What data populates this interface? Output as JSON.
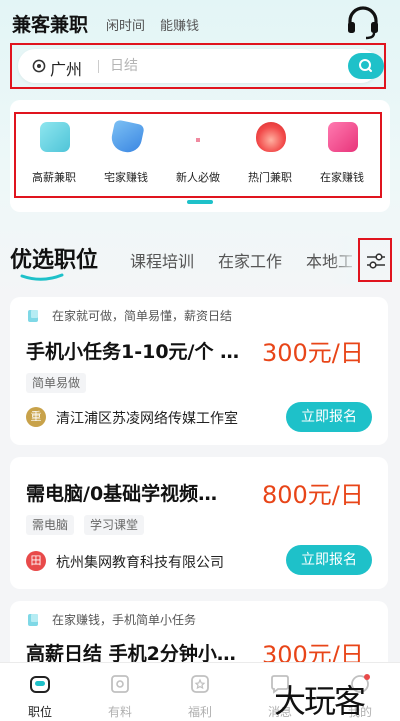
{
  "header": {
    "brand": "兼客兼职",
    "slogan": [
      "闲时间",
      "能赚钱"
    ]
  },
  "search": {
    "city": "广州",
    "placeholder": "日结",
    "icons": [
      "location-icon",
      "search-icon",
      "headset-icon"
    ]
  },
  "categories": [
    {
      "label": "高薪兼职",
      "color": "#4fd0e0"
    },
    {
      "label": "宅家赚钱",
      "color": "#4aa0ea"
    },
    {
      "label": "新人必做",
      "color": "#f08aa0"
    },
    {
      "label": "热门兼职",
      "color": "#f24b4b"
    },
    {
      "label": "在家赚钱",
      "color": "#f0488a"
    }
  ],
  "tabs": [
    "优选职位",
    "课程培训",
    "在家工作",
    "本地工"
  ],
  "jobs": [
    {
      "tip": "在家就可做，简单易懂，薪资日结",
      "title": "手机小任务1-10元/个 …",
      "salary": "300元/日",
      "tags": [
        "简单易做"
      ],
      "company_logo": "重",
      "company_logo_color": "#c8a24a",
      "company": "清江浦区苏凌网络传媒工作室",
      "apply": "立即报名"
    },
    {
      "tip": "",
      "title": "需电脑/0基础学视频…",
      "salary": "800元/日",
      "tags": [
        "需电脑",
        "学习课堂"
      ],
      "company_logo": "田",
      "company_logo_color": "#e84a4a",
      "company": "杭州集网教育科技有限公司",
      "apply": "立即报名"
    },
    {
      "tip": "在家赚钱，手机简单小任务",
      "title": "高薪日结 手机2分钟小…",
      "salary": "300元/日",
      "tags": [],
      "company_logo": "",
      "company_logo_color": "",
      "company": "",
      "apply": ""
    }
  ],
  "nav": [
    {
      "label": "职位",
      "icon": "briefcase-icon",
      "active": true
    },
    {
      "label": "有料",
      "icon": "book-icon",
      "active": false
    },
    {
      "label": "福利",
      "icon": "gift-icon",
      "active": false
    },
    {
      "label": "消息",
      "icon": "message-icon",
      "active": false
    },
    {
      "label": "我的",
      "icon": "profile-icon",
      "active": false
    }
  ],
  "watermark": "大玩客",
  "colors": {
    "accent": "#1ec1c9",
    "salary": "#e84518",
    "highlight_box": "#e0141e"
  }
}
